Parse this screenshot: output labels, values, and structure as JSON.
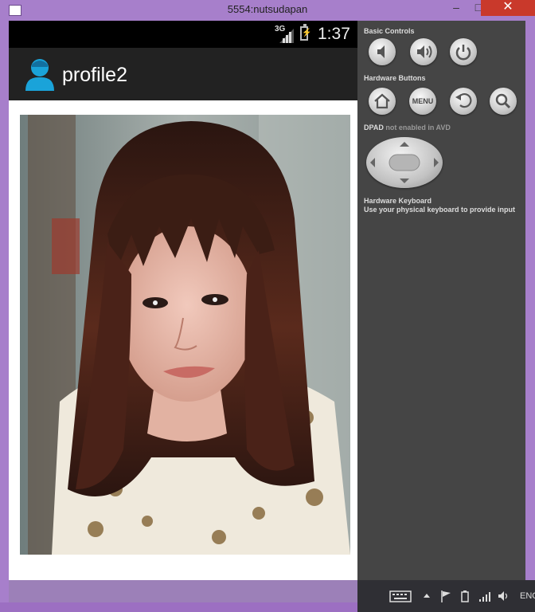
{
  "window": {
    "title": "5554:nutsudapan",
    "minimize_label": "–",
    "maximize_label": "□",
    "close_label": "✕"
  },
  "status_bar": {
    "network": "3G",
    "time": "1:37"
  },
  "action_bar": {
    "title": "profile2",
    "logo_icon": "person-avatar-icon",
    "accent_color": "#1aa3d9"
  },
  "content": {
    "image": "profile-photo"
  },
  "controls": {
    "basic_label": "Basic Controls",
    "hardware_label": "Hardware Buttons",
    "menu_label": "MENU",
    "dpad_label": "DPAD",
    "dpad_note": "not enabled in AVD",
    "keyboard_title": "Hardware Keyboard",
    "keyboard_note": "Use your physical keyboard to provide input"
  },
  "taskbar": {
    "language": "ENG"
  }
}
